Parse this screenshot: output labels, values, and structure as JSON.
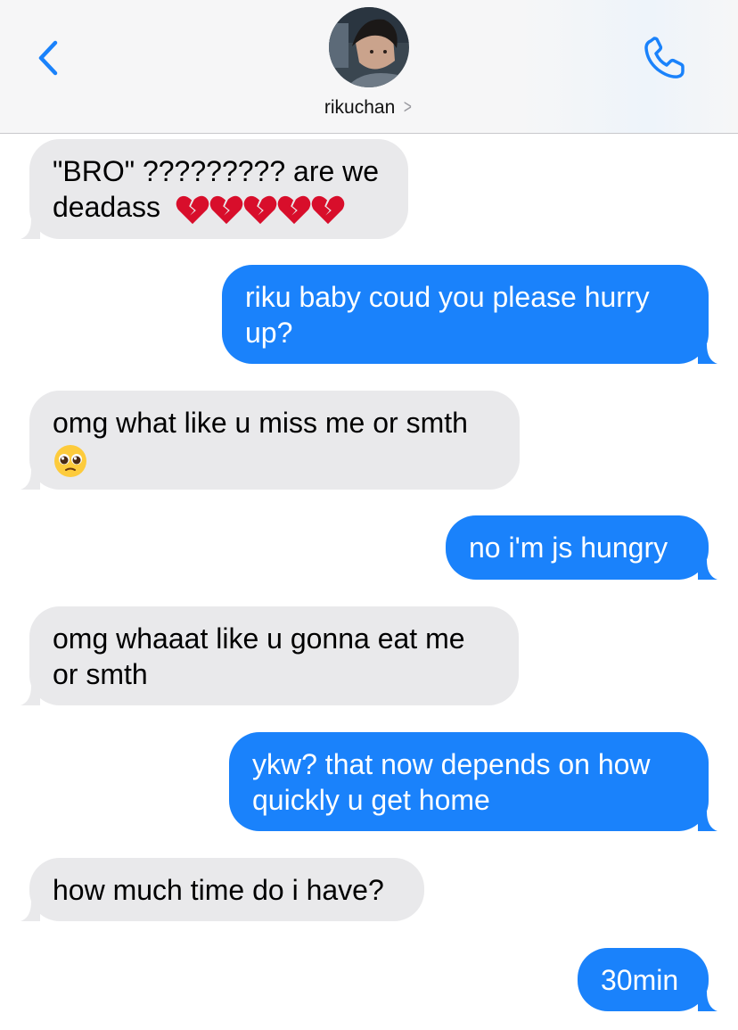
{
  "header": {
    "contact_name": "rikuchan",
    "back_icon": "chevron-left-icon",
    "call_icon": "phone-icon",
    "accent_color": "#1a82fb"
  },
  "messages": [
    {
      "dir": "in",
      "text": "\"BRO\" ????????? are we deadass",
      "emoji": "broken-heart x5"
    },
    {
      "dir": "out",
      "text": "riku baby coud you please hurry up?"
    },
    {
      "dir": "in",
      "text": "omg what like u miss me or smth",
      "emoji": "pleading-face"
    },
    {
      "dir": "out",
      "text": "no i'm js hungry"
    },
    {
      "dir": "in",
      "text": "omg whaaat like u gonna eat me or smth"
    },
    {
      "dir": "out",
      "text": "ykw? that now depends on how quickly u get home"
    },
    {
      "dir": "in",
      "text": "how much time do i have?"
    },
    {
      "dir": "out",
      "text": "30min"
    }
  ],
  "colors": {
    "incoming_bubble": "#e9e9eb",
    "outgoing_bubble": "#1a82fb"
  }
}
